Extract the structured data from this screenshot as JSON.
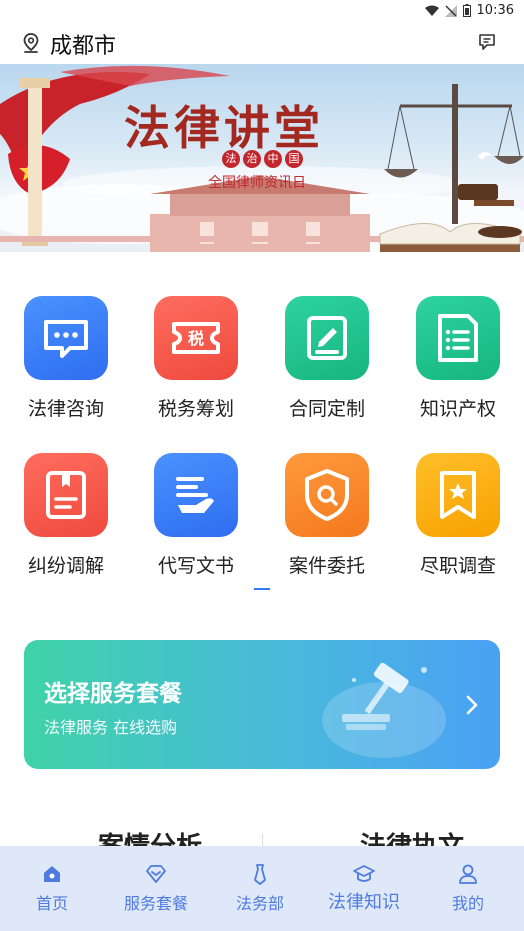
{
  "status_bar": {
    "time": "10:36"
  },
  "header": {
    "location": "成都市"
  },
  "banner": {
    "title": "法律讲堂",
    "badge": [
      "法",
      "治",
      "中",
      "国"
    ],
    "subtitle": "全国律师资讯日"
  },
  "services": [
    {
      "label": "法律咨询",
      "icon": "chat-bubble-icon",
      "color": "#2f7df6"
    },
    {
      "label": "税务筹划",
      "icon": "tax-ticket-icon",
      "color": "#f2574a"
    },
    {
      "label": "合同定制",
      "icon": "edit-document-icon",
      "color": "#21c08b"
    },
    {
      "label": "知识产权",
      "icon": "list-document-icon",
      "color": "#21c08b"
    },
    {
      "label": "纠纷调解",
      "icon": "book-icon",
      "color": "#f2574a"
    },
    {
      "label": "代写文书",
      "icon": "hand-writing-icon",
      "color": "#2f7df6"
    },
    {
      "label": "案件委托",
      "icon": "shield-search-icon",
      "color": "#fb8b2c"
    },
    {
      "label": "尽职调查",
      "icon": "star-bookmark-icon",
      "color": "#fbad14"
    }
  ],
  "promo": {
    "title": "选择服务套餐",
    "subtitle": "法律服务 在线选购"
  },
  "sections": {
    "left": "案情分析",
    "right": "法律执文"
  },
  "tabs": [
    {
      "label": "首页",
      "icon": "home-icon",
      "active": true
    },
    {
      "label": "服务套餐",
      "icon": "package-icon",
      "active": false
    },
    {
      "label": "法务部",
      "icon": "tie-icon",
      "active": false
    },
    {
      "label": "法律知识",
      "icon": "graduation-cap-icon",
      "active": false
    },
    {
      "label": "我的",
      "icon": "user-icon",
      "active": false
    }
  ]
}
